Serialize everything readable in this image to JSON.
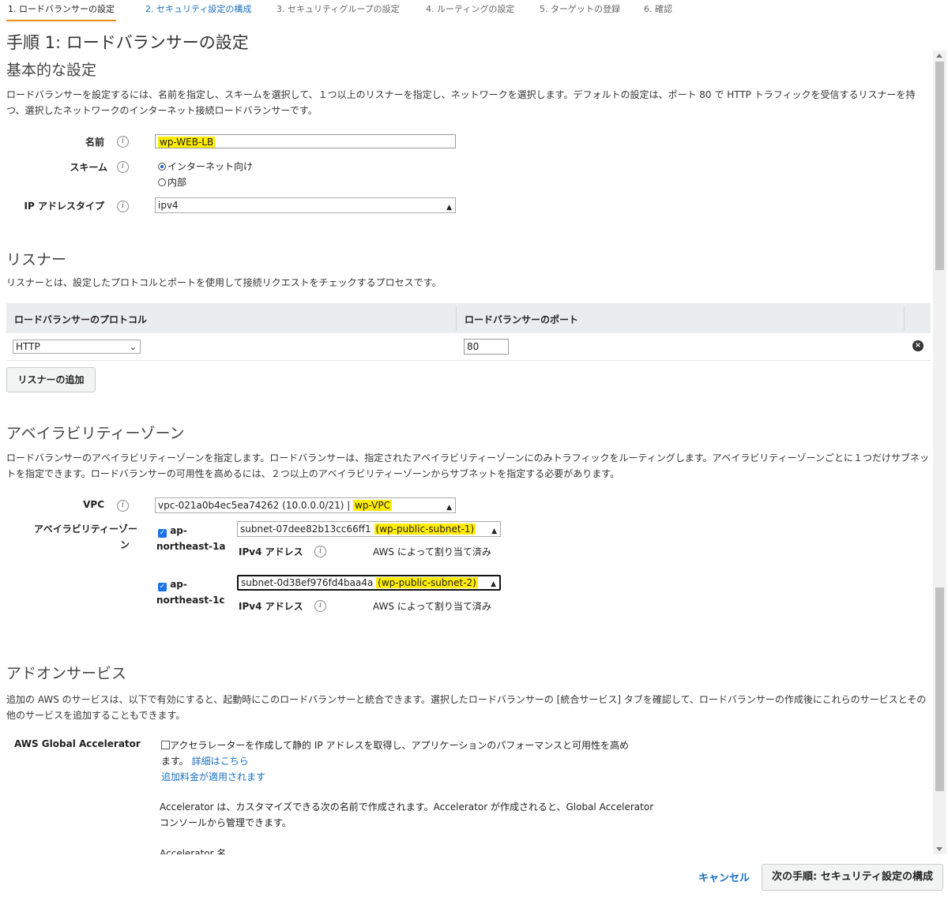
{
  "steps": [
    {
      "label": "1. ロードバランサーの設定"
    },
    {
      "label": "2. セキュリティ設定の構成"
    },
    {
      "label": "3. セキュリティグループの設定"
    },
    {
      "label": "4. ルーティングの設定"
    },
    {
      "label": "5. ターゲットの登録"
    },
    {
      "label": "6. 確認"
    }
  ],
  "page_title": "手順 1: ロードバランサーの設定",
  "basic": {
    "heading": "基本的な設定",
    "desc": "ロードバランサーを設定するには、名前を指定し、スキームを選択して、１つ以上のリスナーを指定し、ネットワークを選択します。デフォルトの設定は、ポート 80 で HTTP トラフィックを受信するリスナーを持つ、選択したネットワークのインターネット接続ロードバランサーです。",
    "name_label": "名前",
    "name_value": "wp-WEB-LB",
    "scheme_label": "スキーム",
    "scheme_internet": "インターネット向け",
    "scheme_internal": "内部",
    "iptype_label": "IP アドレスタイプ",
    "iptype_value": "ipv4"
  },
  "listener": {
    "heading": "リスナー",
    "desc": "リスナーとは、設定したプロトコルとポートを使用して接続リクエストをチェックするプロセスです。",
    "col_protocol": "ロードバランサーのプロトコル",
    "col_port": "ロードバランサーのポート",
    "protocol_value": "HTTP",
    "port_value": "80",
    "add_button": "リスナーの追加"
  },
  "az": {
    "heading": "アベイラビリティーゾーン",
    "desc": "ロードバランサーのアベイラビリティーゾーンを指定します。ロードバランサーは、指定されたアベイラビリティーゾーンにのみトラフィックをルーティングします。アベイラビリティーゾーンごとに１つだけサブネットを指定できます。ロードバランサーの可用性を高めるには、２つ以上のアベイラビリティーゾーンからサブネットを指定する必要があります。",
    "vpc_label": "VPC",
    "vpc_id": "vpc-021a0b4ec5ea74262 (10.0.0.0/21) |",
    "vpc_name": "wp-VPC",
    "zones_label_1": "アベイラビリティーゾー",
    "zones_label_2": "ン",
    "zones": [
      {
        "name_1": "ap-",
        "name_2": "northeast-1a",
        "subnet_id": "subnet-07dee82b13cc66ff1",
        "subnet_name": "(wp-public-subnet-1)",
        "ipv4_label": "IPv4 アドレス",
        "ipv4_value": "AWS によって割り当て済み"
      },
      {
        "name_1": "ap-",
        "name_2": "northeast-1c",
        "subnet_id": "subnet-0d38ef976fd4baa4a",
        "subnet_name": "(wp-public-subnet-2)",
        "ipv4_label": "IPv4 アドレス",
        "ipv4_value": "AWS によって割り当て済み"
      }
    ]
  },
  "addon": {
    "heading": "アドオンサービス",
    "desc": "追加の AWS のサービスは、以下で有効にすると、起動時にこのロードバランサーと統合できます。選択したロードバランサーの [統合サービス] タブを確認して、ロードバランサーの作成後にこれらのサービスとその他のサービスを追加することもできます。",
    "ga_label": "AWS Global Accelerator",
    "ga_text_1": "アクセラレーターを作成して静的 IP アドレスを取得し、アプリケーションのパフォーマンスと可用性を高め",
    "ga_text_2": "ます。",
    "ga_link_detail": "詳細はこちら",
    "ga_link_fee": "追加料金が適用されます",
    "ga_note_1": "Accelerator は、カスタマイズできる次の名前で作成されます。Accelerator が作成されると、Global Accelerator",
    "ga_note_2": "コンソールから管理できます。",
    "ga_name_label": "Accelerator 名"
  },
  "footer": {
    "cancel": "キャンセル",
    "next": "次の手順: セキュリティ設定の構成"
  }
}
